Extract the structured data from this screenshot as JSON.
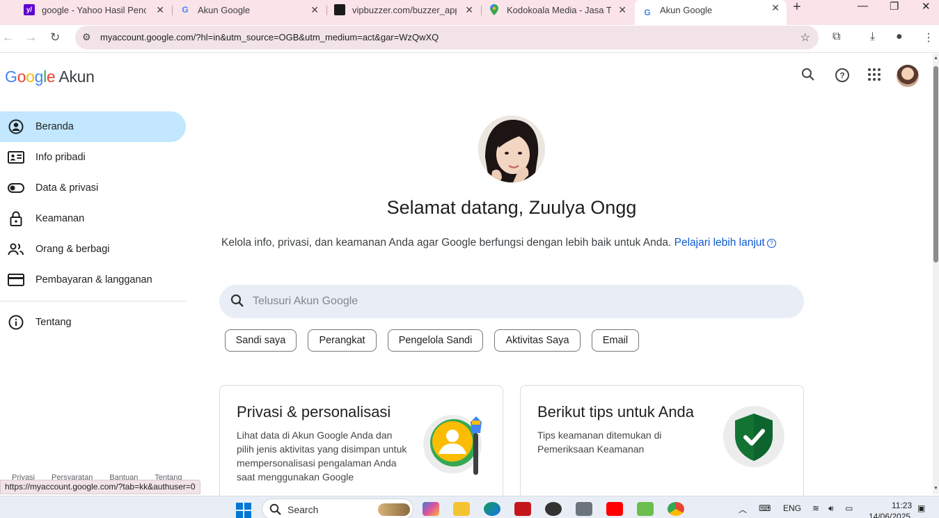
{
  "browser": {
    "tabs": [
      {
        "title": "google - Yahoo Hasil Pencar",
        "favicon": "yahoo-icon",
        "favicon_text": "y/"
      },
      {
        "title": "Akun Google",
        "favicon": "google-g-icon",
        "favicon_text": "G"
      },
      {
        "title": "vipbuzzer.com/buzzer_app/t",
        "favicon": "vipbuzzer-icon",
        "favicon_text": ""
      },
      {
        "title": "Kodokoala Media - Jasa Tam",
        "favicon": "maps-pin-icon",
        "favicon_text": ""
      },
      {
        "title": "Akun Google",
        "favicon": "google-g-icon",
        "favicon_text": "G"
      }
    ],
    "active_tab_index": 4,
    "url": "myaccount.google.com/?hl=in&utm_source=OGB&utm_medium=act&gar=WzQwXQ",
    "status_url": "https://myaccount.google.com/?tab=kk&authuser=0"
  },
  "header": {
    "logo_text": "Google",
    "product": "Akun"
  },
  "sidebar": {
    "items": [
      {
        "label": "Beranda",
        "icon": "account-circle-icon",
        "active": true
      },
      {
        "label": "Info pribadi",
        "icon": "id-card-icon",
        "active": false
      },
      {
        "label": "Data & privasi",
        "icon": "toggle-icon",
        "active": false
      },
      {
        "label": "Keamanan",
        "icon": "lock-icon",
        "active": false
      },
      {
        "label": "Orang & berbagi",
        "icon": "people-icon",
        "active": false
      },
      {
        "label": "Pembayaran & langganan",
        "icon": "credit-card-icon",
        "active": false
      }
    ],
    "about": {
      "label": "Tentang",
      "icon": "info-icon"
    },
    "footer_links": [
      "Privasi",
      "Persyaratan",
      "Bantuan",
      "Tentang"
    ]
  },
  "main": {
    "welcome": "Selamat datang, Zuulya Ongg",
    "subtitle": "Kelola info, privasi, dan keamanan Anda agar Google berfungsi dengan lebih baik untuk Anda.",
    "learn_more": "Pelajari lebih lanjut",
    "search_placeholder": "Telusuri Akun Google",
    "chips": [
      "Sandi saya",
      "Perangkat",
      "Pengelola Sandi",
      "Aktivitas Saya",
      "Email"
    ],
    "cards": [
      {
        "title": "Privasi & personalisasi",
        "body": "Lihat data di Akun Google Anda dan pilih jenis aktivitas yang disimpan untuk mempersonalisasi pengalaman Anda saat menggunakan Google",
        "illustration": "privacy-illustration-icon"
      },
      {
        "title": "Berikut tips untuk Anda",
        "body": "Tips keamanan ditemukan di Pemeriksaan Keamanan",
        "illustration": "shield-check-icon"
      }
    ]
  },
  "taskbar": {
    "search_label": "Search",
    "language": "ENG",
    "time": "11:23",
    "date": "14/06/2025"
  },
  "colors": {
    "tabstrip_bg": "#fbe3ea",
    "active_nav_bg": "#c2e7ff",
    "link_blue": "#0b57d0",
    "search_bg": "#e9eef6",
    "shield_green": "#137333"
  }
}
